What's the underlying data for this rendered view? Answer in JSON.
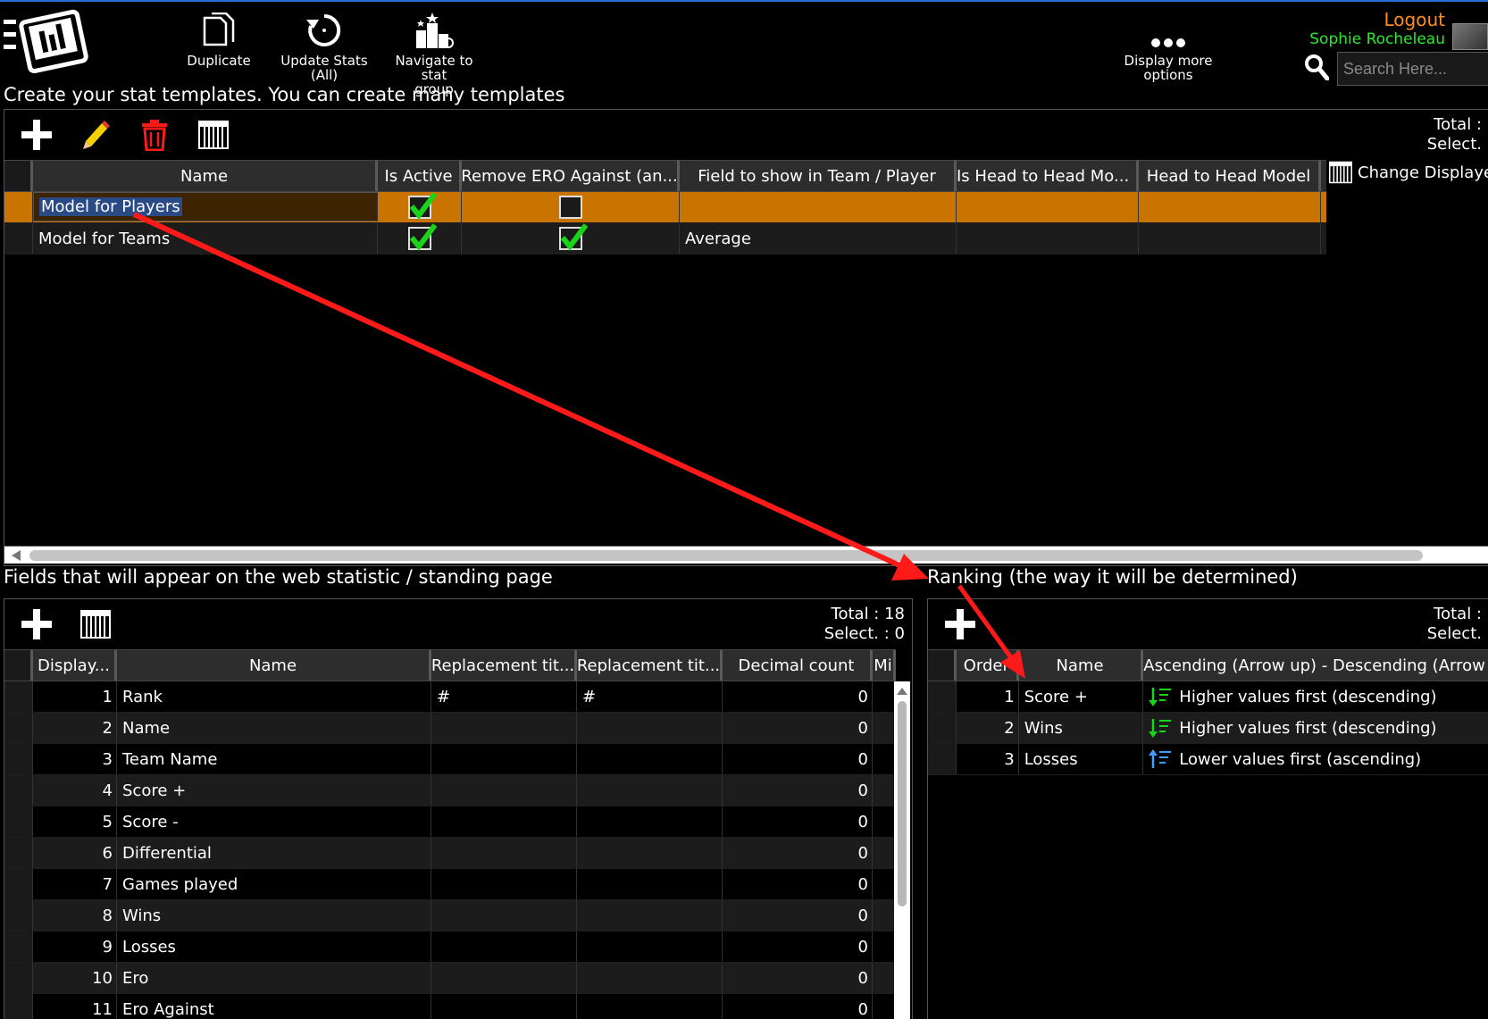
{
  "toolbar": {
    "duplicate": "Duplicate",
    "update_stats": [
      "Update Stats",
      "(All)"
    ],
    "navigate": [
      "Navigate to stat",
      "group"
    ],
    "more": [
      "Display more",
      "options"
    ],
    "logout": "Logout",
    "username": "Sophie Rocheleau",
    "search_placeholder": "Search Here..."
  },
  "templates": {
    "title": "Create your stat templates. You can create many templates",
    "total_label": "Total :",
    "select_label": "Select.",
    "change_columns": "Change Displayed",
    "columns": [
      "Name",
      "Is Active",
      "Remove ERO Against (an...",
      "Field to show in Team / Player",
      "Is Head to Head Mo...",
      "Head to Head Model"
    ],
    "rows": [
      {
        "name": "Model for Players",
        "is_active": true,
        "remove_ero": false,
        "field_show": "",
        "is_h2h": "",
        "h2h_model": ""
      },
      {
        "name": "Model for Teams",
        "is_active": true,
        "remove_ero": true,
        "field_show": "Average",
        "is_h2h": "",
        "h2h_model": ""
      }
    ]
  },
  "fields": {
    "title": "Fields that will appear on the web statistic / standing page",
    "total_label": "Total : 18",
    "select_label": "Select. : 0",
    "columns": [
      "Display...",
      "Name",
      "Replacement tit...",
      "Replacement tit...",
      "Decimal count",
      "Mi"
    ],
    "rows": [
      {
        "order": "1",
        "name": "Rank",
        "r1": "#",
        "r2": "#",
        "dec": "0"
      },
      {
        "order": "2",
        "name": "Name",
        "r1": "",
        "r2": "",
        "dec": "0"
      },
      {
        "order": "3",
        "name": "Team Name",
        "r1": "",
        "r2": "",
        "dec": "0"
      },
      {
        "order": "4",
        "name": "Score +",
        "r1": "",
        "r2": "",
        "dec": "0"
      },
      {
        "order": "5",
        "name": "Score -",
        "r1": "",
        "r2": "",
        "dec": "0"
      },
      {
        "order": "6",
        "name": "Differential",
        "r1": "",
        "r2": "",
        "dec": "0"
      },
      {
        "order": "7",
        "name": "Games played",
        "r1": "",
        "r2": "",
        "dec": "0"
      },
      {
        "order": "8",
        "name": "Wins",
        "r1": "",
        "r2": "",
        "dec": "0"
      },
      {
        "order": "9",
        "name": "Losses",
        "r1": "",
        "r2": "",
        "dec": "0"
      },
      {
        "order": "10",
        "name": "Ero",
        "r1": "",
        "r2": "",
        "dec": "0"
      },
      {
        "order": "11",
        "name": "Ero Against",
        "r1": "",
        "r2": "",
        "dec": "0"
      }
    ]
  },
  "ranking": {
    "title": "Ranking (the way it will be determined)",
    "total_label": "Total :",
    "select_label": "Select.",
    "columns": [
      "Order",
      "Name",
      "Ascending (Arrow up) - Descending (Arrow"
    ],
    "rows": [
      {
        "order": "1",
        "name": "Score +",
        "dir": "desc",
        "label": "Higher values first (descending)"
      },
      {
        "order": "2",
        "name": "Wins",
        "dir": "desc",
        "label": "Higher values first (descending)"
      },
      {
        "order": "3",
        "name": "Losses",
        "dir": "asc",
        "label": "Lower values first (ascending)"
      }
    ]
  },
  "colors": {
    "selected_row": "#c97400",
    "check_green": "#19d419",
    "annotation_red": "#ff1a1a",
    "logout": "#ff8c1a",
    "username": "#2ee82e"
  }
}
